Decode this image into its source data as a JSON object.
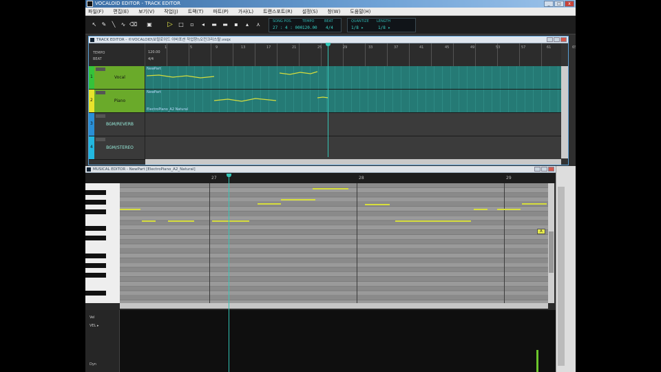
{
  "window": {
    "title": "VOCALOID EDITOR - TRACK EDITOR"
  },
  "menu": [
    "파일(F)",
    "편집(E)",
    "보기(V)",
    "작업(J)",
    "트랙(T)",
    "파트(P)",
    "가사(L)",
    "트랜스포트(R)",
    "설정(S)",
    "창(W)",
    "도움말(H)"
  ],
  "toolbar": {
    "tools": [
      "arrow",
      "pencil",
      "line",
      "eraser",
      "scissors",
      "save",
      "play",
      "stop",
      "record",
      "rewind",
      "forward",
      "start",
      "end",
      "loop",
      "metronome"
    ],
    "song_position_label": "SONG POS.",
    "song_position_value": "27 : 4 : 000",
    "tempo_label": "TEMPO",
    "tempo_value": "120.00",
    "beat_label": "BEAT",
    "beat_value": "4/4",
    "quantize_label": "QUANTIZE",
    "quantize_value": "1/8 ▸",
    "length_label": "LENGTH",
    "length_value": "1/8 ▸"
  },
  "track_editor": {
    "title": "TRACK EDITOR - ©VOCALOID\\보컬로이드 아바포션 작업창\\\\오전크리스탈.vsqx",
    "tempo_label": "TEMPO",
    "tempo_value": "120.00",
    "beat_label": "BEAT",
    "beat_value": "4/4",
    "ruler": [
      "1",
      "5",
      "9",
      "13",
      "17",
      "21",
      "25",
      "29",
      "33",
      "37",
      "41",
      "45",
      "49",
      "53",
      "57",
      "61",
      "65"
    ],
    "tracks": [
      {
        "num": "1",
        "name": "Vocal",
        "color": "#35c33a",
        "type": "seq",
        "part_label": "NewPart",
        "part_sub": ""
      },
      {
        "num": "2",
        "name": "Piano",
        "color": "#e8e32c",
        "type": "seq",
        "part_label": "NewPart",
        "part_sub": "ElectroPiano_A2 Natural"
      },
      {
        "num": "3",
        "name": "BGM/REVERB",
        "color": "#2a8fd6",
        "type": "empty",
        "part_label": "",
        "part_sub": ""
      },
      {
        "num": "4",
        "name": "BGM/STEREO",
        "color": "#22b8e0",
        "type": "empty",
        "part_label": "",
        "part_sub": ""
      }
    ]
  },
  "musical_editor": {
    "title": "MUSICAL EDITOR - NewPart [ElectroPiano_A2_Natural]",
    "measures": [
      "27",
      "28",
      "29"
    ],
    "selected_note": "A",
    "control_labels": [
      "Vel",
      "VEL ▸",
      "Dyn"
    ]
  },
  "colors": {
    "accent": "#34c6b8",
    "note": "#d7de3c",
    "lane": "#257a75"
  }
}
